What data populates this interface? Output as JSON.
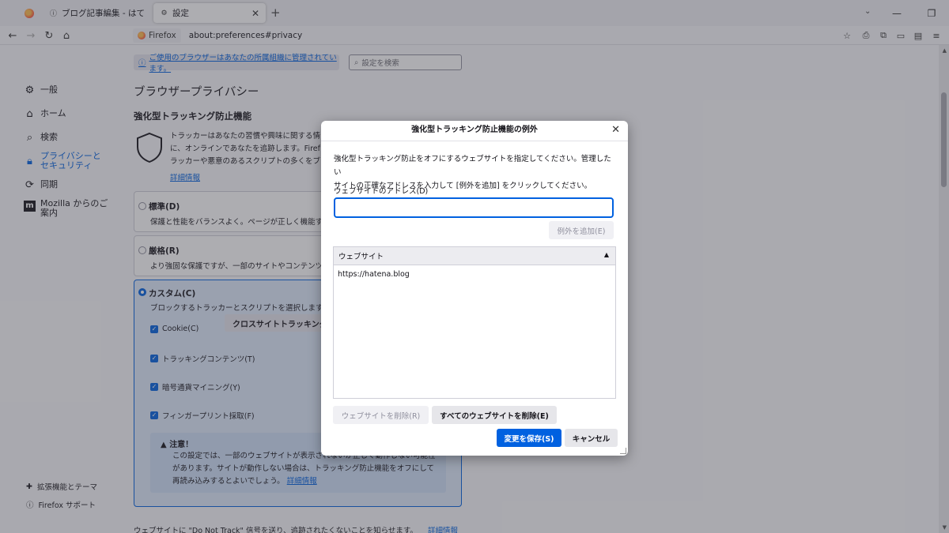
{
  "tabs": [
    {
      "title": "ブログ記事編集 - はてなブログ×"
    },
    {
      "title": "設定"
    }
  ],
  "navbar": {
    "identity_label": "Firefox",
    "url": "about:preferences#privacy"
  },
  "sidebar": {
    "items": [
      {
        "label": "一般",
        "icon": "gear-icon"
      },
      {
        "label": "ホーム",
        "icon": "home-icon"
      },
      {
        "label": "検索",
        "icon": "search-icon"
      },
      {
        "label": "プライバシーとセキュリティ",
        "icon": "lock-icon"
      },
      {
        "label": "同期",
        "icon": "sync-icon"
      },
      {
        "label": "Mozilla からのご案内",
        "icon": "mozilla-icon"
      }
    ],
    "footer": [
      {
        "label": "拡張機能とテーマ",
        "icon": "puzzle-icon"
      },
      {
        "label": "Firefox サポート",
        "icon": "help-icon"
      }
    ]
  },
  "main": {
    "managed_notice": "ご使用のブラウザーはあなたの所属組織に管理されています。",
    "search_placeholder": "設定を検索",
    "heading": "ブラウザープライバシー",
    "etp_heading": "強化型トラッキング防止機能",
    "etp_desc_lines": [
      "トラッカーはあなたの習慣や興味に関する情報",
      "に、オンラインであなたを追跡します。Firefox",
      "ラッカーや悪意のあるスクリプトの多くをブロ"
    ],
    "etp_learn_more": "詳細情報",
    "standard": {
      "title": "標準(D)",
      "desc": "保護と性能をバランスよく。ページが正しく機能す"
    },
    "strict": {
      "title": "厳格(R)",
      "desc": "より強固な保護ですが、一部のサイトやコンテンツ"
    },
    "custom": {
      "title": "カスタム(C)",
      "desc": "ブロックするトラッカーとスクリプトを選択します。",
      "cookie_label": "Cookie(C)",
      "cookie_select": "クロスサイトトラッキング",
      "tracking_content": "トラッキングコンテンツ(T)",
      "cryptomining": "暗号通貨マイニング(Y)",
      "fingerprinting": "フィンガープリント採取(F)",
      "warning_title": "注意！",
      "warning_lines": [
        "この設定では、一部のウェブサイトが表示されないか正しく動作しない可能性",
        "があります。サイトが動作しない場合は、トラッキング防止機能をオフにして",
        "再読み込みするとよいでしょう。"
      ],
      "warning_link": "詳細情報"
    },
    "dnt_text": "ウェブサイトに \"Do Not Track\" 信号を送り、追跡されたくないことを知らせます。",
    "dnt_link": "詳細情報"
  },
  "dialog": {
    "title": "強化型トラッキング防止機能の例外",
    "desc_line1": "強化型トラッキング防止をオフにするウェブサイトを指定してください。管理したい",
    "desc_line2": "サイトの正確なアドレスを入力して [例外を追加] をクリックしてください。",
    "address_label": "ウェブサイトのアドレス(D)",
    "address_value": "",
    "add_button": "例外を追加(E)",
    "list_header": "ウェブサイト",
    "sites": [
      "https://hatena.blog"
    ],
    "remove_button": "ウェブサイトを削除(R)",
    "remove_all_button": "すべてのウェブサイトを削除(E)",
    "save_button": "変更を保存(S)",
    "cancel_button": "キャンセル"
  },
  "colors": {
    "accent": "#0061e0",
    "overlay": "#3c3c46"
  }
}
